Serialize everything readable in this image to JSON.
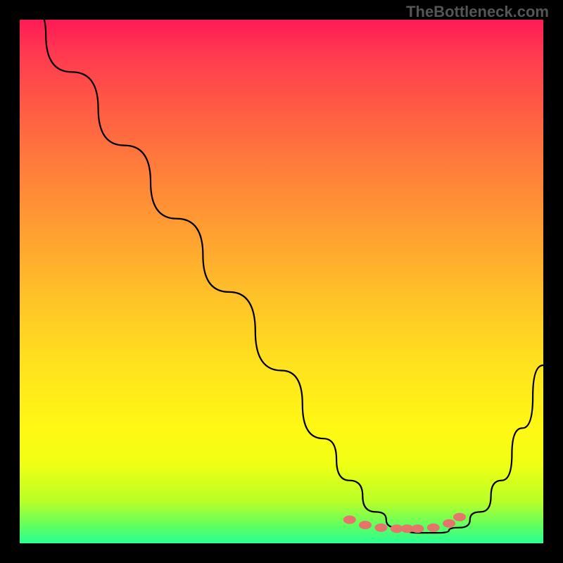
{
  "watermark": "TheBottleneck.com",
  "chart_data": {
    "type": "line",
    "title": "",
    "xlabel": "",
    "ylabel": "",
    "xlim": [
      0,
      100
    ],
    "ylim": [
      0,
      100
    ],
    "series": [
      {
        "name": "curve",
        "x": [
          0,
          10,
          20,
          30,
          40,
          50,
          58,
          63,
          68,
          72,
          76,
          80,
          84,
          88,
          92,
          96,
          100
        ],
        "y": [
          104,
          90,
          76,
          62,
          48,
          33,
          20,
          12,
          6,
          3,
          2,
          2,
          3,
          6,
          12,
          22,
          34
        ]
      }
    ],
    "markers": {
      "name": "bottom-dots",
      "x": [
        63,
        66,
        69,
        72,
        74,
        76,
        79,
        82,
        84
      ],
      "y": [
        4.5,
        3.5,
        3.0,
        2.8,
        2.8,
        2.8,
        3.0,
        3.8,
        5.0
      ],
      "color": "#e4756b"
    }
  }
}
